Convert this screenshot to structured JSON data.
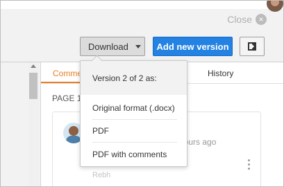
{
  "header": {
    "close_label": "Close",
    "close_icon": "×"
  },
  "toolbar": {
    "download_label": "Download",
    "add_version_label": "Add new version"
  },
  "tabs": {
    "comments_label": "Comme",
    "history_label": "History"
  },
  "page_label": "PAGE 1",
  "comment_card": {
    "time_text": "hours ago",
    "author_text": "Rebh"
  },
  "download_menu": {
    "header": "Version 2 of 2 as:",
    "items": [
      "Original format (.docx)",
      "PDF",
      "PDF with comments"
    ]
  },
  "colors": {
    "accent_blue": "#2382e2",
    "tab_active": "#e67e22"
  }
}
